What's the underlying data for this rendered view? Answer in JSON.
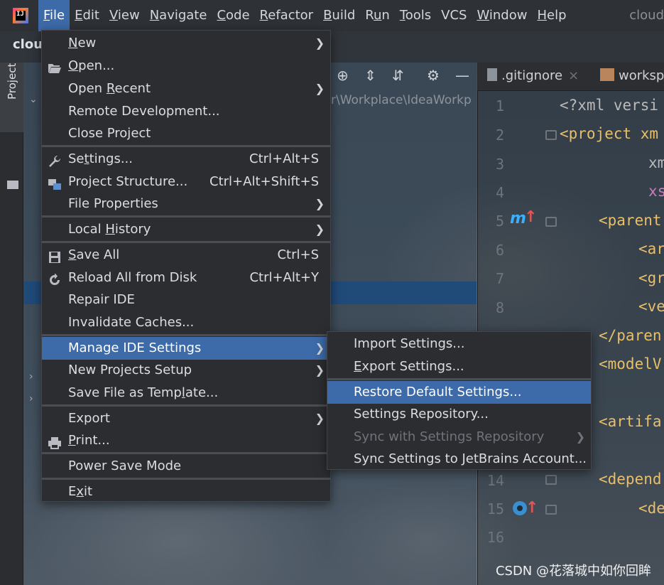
{
  "menubar": {
    "logo_text": "IJ",
    "items": [
      {
        "label": "File",
        "mn": "F",
        "rest": "ile",
        "active": true
      },
      {
        "label": "Edit",
        "mn": "E",
        "rest": "dit"
      },
      {
        "label": "View",
        "mn": "V",
        "rest": "iew"
      },
      {
        "label": "Navigate",
        "mn": "N",
        "rest": "avigate"
      },
      {
        "label": "Code",
        "mn": "C",
        "rest": "ode"
      },
      {
        "label": "Refactor",
        "mn": "R",
        "rest": "efactor"
      },
      {
        "label": "Build",
        "mn": "B",
        "rest": "uild"
      },
      {
        "label": "Run",
        "pre": "R",
        "mn": "u",
        "rest": "n"
      },
      {
        "label": "Tools",
        "mn": "T",
        "rest": "ools"
      },
      {
        "label": "VCS",
        "mn": "",
        "rest": "VCS"
      },
      {
        "label": "Window",
        "mn": "W",
        "rest": "indow"
      },
      {
        "label": "Help",
        "mn": "H",
        "rest": "elp"
      }
    ],
    "window_title": "cloud"
  },
  "project": {
    "short_name": "cloud",
    "tool_tab": "Project",
    "path_text": "r\\Workplace\\IdeaWorkp"
  },
  "editor": {
    "tabs": [
      {
        "label": ".gitignore"
      },
      {
        "label": "worksp"
      }
    ],
    "line_numbers": [
      "1",
      "2",
      "3",
      "4",
      "5",
      "6",
      "7",
      "8",
      "14",
      "15",
      "16"
    ],
    "code": [
      {
        "text": "<?xml versi"
      },
      {
        "text": "<project xm"
      },
      {
        "text": "xm"
      },
      {
        "text": "xs"
      },
      {
        "text": "<parent"
      },
      {
        "text": "<ar"
      },
      {
        "text": "<gr"
      },
      {
        "text": "<ve"
      },
      {
        "text": "</paren"
      },
      {
        "text": "<modelV"
      },
      {
        "text": "<artifa"
      },
      {
        "text": "<depend"
      },
      {
        "text": "<de"
      }
    ],
    "marker_m": "m"
  },
  "file_menu": {
    "items": [
      {
        "label": "New",
        "mn": "N",
        "rest": "ew",
        "submenu": true
      },
      {
        "label": "Open...",
        "mn": "O",
        "rest": "pen...",
        "icon": "folder-open-icon"
      },
      {
        "label": "Open Recent",
        "pre": "Open ",
        "mn": "R",
        "rest": "ecent",
        "submenu": true
      },
      {
        "label": "Remote Development...",
        "pre": "Remote Development...",
        "mn": "",
        "rest": ""
      },
      {
        "label": "Close Project",
        "pre": "Close Project",
        "mn": "",
        "rest": ""
      },
      {
        "label": "Settings...",
        "pre": "Se",
        "mn": "t",
        "rest": "tings...",
        "shortcut": "Ctrl+Alt+S",
        "icon": "wrench-icon"
      },
      {
        "label": "Project Structure...",
        "pre": "Project Structure...",
        "mn": "",
        "rest": "",
        "shortcut": "Ctrl+Alt+Shift+S",
        "icon": "project-structure-icon"
      },
      {
        "label": "File Properties",
        "pre": "File Properties",
        "mn": "",
        "rest": "",
        "submenu": true
      },
      {
        "label": "Local History",
        "pre": "Local ",
        "mn": "H",
        "rest": "istory",
        "submenu": true
      },
      {
        "label": "Save All",
        "mn": "S",
        "rest": "ave All",
        "shortcut": "Ctrl+S",
        "icon": "save-icon"
      },
      {
        "label": "Reload All from Disk",
        "pre": "Reload All from Disk",
        "mn": "",
        "rest": "",
        "shortcut": "Ctrl+Alt+Y",
        "icon": "reload-icon"
      },
      {
        "label": "Repair IDE",
        "pre": "Repair IDE",
        "mn": "",
        "rest": ""
      },
      {
        "label": "Invalidate Caches...",
        "pre": "Invalidate Caches...",
        "mn": "",
        "rest": ""
      },
      {
        "label": "Manage IDE Settings",
        "pre": "Manage IDE Settings",
        "mn": "",
        "rest": "",
        "submenu": true,
        "highlight": true
      },
      {
        "label": "New Projects Setup",
        "pre": "New Projects Setup",
        "mn": "",
        "rest": "",
        "submenu": true
      },
      {
        "label": "Save File as Template...",
        "pre": "Save File as Temp",
        "mn": "l",
        "rest": "ate..."
      },
      {
        "label": "Export",
        "pre": "Export",
        "mn": "",
        "rest": "",
        "submenu": true
      },
      {
        "label": "Print...",
        "mn": "P",
        "rest": "rint...",
        "icon": "print-icon"
      },
      {
        "label": "Power Save Mode",
        "pre": "Power Save Mode",
        "mn": "",
        "rest": ""
      },
      {
        "label": "Exit",
        "pre": "E",
        "mn": "x",
        "rest": "it"
      }
    ]
  },
  "manage_submenu": {
    "items": [
      {
        "label": "Import Settings...",
        "pre": "Import Settings...",
        "mn": "",
        "rest": ""
      },
      {
        "label": "Export Settings...",
        "mn": "E",
        "rest": "xport Settings..."
      },
      {
        "label": "Restore Default Settings...",
        "pre": "Restore Default Settings...",
        "mn": "",
        "rest": "",
        "highlight": true
      },
      {
        "label": "Settings Repository...",
        "pre": "Settings Repository...",
        "mn": "",
        "rest": ""
      },
      {
        "label": "Sync with Settings Repository",
        "pre": "Sync with Settings Repository",
        "mn": "",
        "rest": "",
        "disabled": true,
        "submenu": true
      },
      {
        "label": "Sync Settings to JetBrains Account...",
        "pre": "Sync Settings to JetBrains Account...",
        "mn": "",
        "rest": ""
      }
    ]
  },
  "watermark": "CSDN @花落城中如你回眸",
  "colors": {
    "highlight": "#3d6aa8",
    "menu_bg": "#2b2d30",
    "xml_tag": "#e8bf6a",
    "xml_attr": "#bababa",
    "xml_ns": "#c77dbb"
  }
}
